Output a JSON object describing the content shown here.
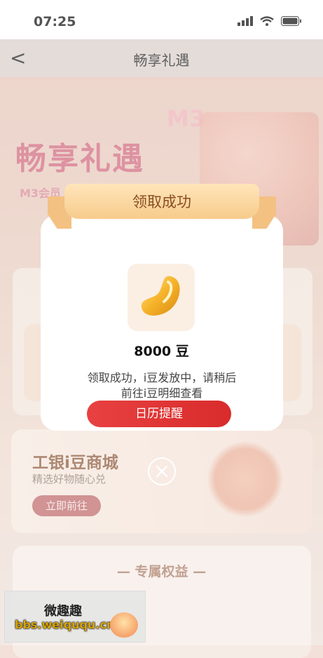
{
  "status_bar": {
    "time": "07:25"
  },
  "nav": {
    "back_label": "<",
    "title": "畅享礼遇"
  },
  "banner": {
    "title": "畅享礼遇",
    "badge": "M3",
    "subtitle": "M3会员"
  },
  "shop": {
    "title": "工银i豆商城",
    "subtitle": "精选好物随心兑",
    "button": "立即前往"
  },
  "benefits": {
    "title": "— 专属权益 —"
  },
  "modal": {
    "header": "领取成功",
    "amount": "8000 豆",
    "message_line1": "领取成功，i豆发放中，请稍后",
    "message_line2": "前往i豆明细查看",
    "button": "日历提醒"
  },
  "close_icon": "close-circle-icon",
  "watermark": {
    "line1": "微趣趣",
    "line2": "bbs.weiququ.cn"
  },
  "colors": {
    "accent": "#e23a3a",
    "ribbon": "#f7cb8c",
    "overlay": "rgba(255,255,255,0.28)"
  }
}
